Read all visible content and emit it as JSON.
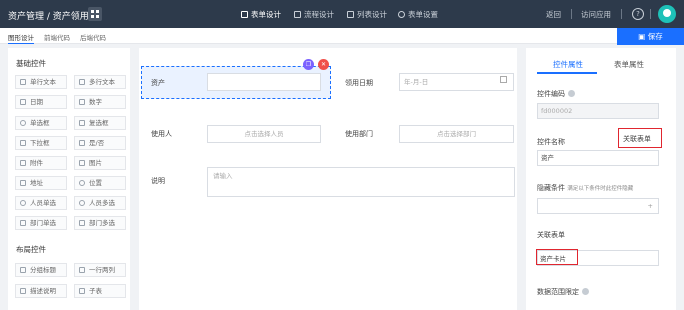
{
  "topbar": {
    "title": "资产管理 / 资产领用",
    "nav": [
      "表单设计",
      "流程设计",
      "列表设计",
      "表单设置"
    ],
    "back": "返回",
    "visit": "访问应用",
    "help": "?"
  },
  "subbar": {
    "tabs": [
      "图形设计",
      "前端代码",
      "后端代码"
    ],
    "save": "保存"
  },
  "left": {
    "basic_title": "基础控件",
    "basic_items": [
      "单行文本",
      "多行文本",
      "日期",
      "数字",
      "单选框",
      "复选框",
      "下拉框",
      "是/否",
      "附件",
      "图片",
      "地址",
      "位置",
      "人员单选",
      "人员多选",
      "部门单选",
      "部门多选"
    ],
    "layout_title": "布局控件",
    "layout_items": [
      "分组标题",
      "一行两列",
      "描述说明",
      "子表"
    ]
  },
  "canvas": {
    "asset_label": "资产",
    "date_label": "领用日期",
    "date_placeholder": "年-月-日",
    "user_label": "使用人",
    "user_placeholder": "点击选择人员",
    "dept_label": "使用部门",
    "dept_placeholder": "点击选择部门",
    "note_label": "说明",
    "note_placeholder": "请输入"
  },
  "props": {
    "tab_control": "控件属性",
    "tab_form": "表单属性",
    "code_label": "控件编码",
    "code_value": "fd000002",
    "name_label": "控件名称",
    "type_badge": "关联表单",
    "name_value": "资产",
    "hide_label": "隐藏条件",
    "hide_hint": "满足以下条件时此控件隐藏",
    "plus": "+",
    "rel_label": "关联表单",
    "rel_value": "资产卡片",
    "range_label": "数据范围限定"
  },
  "colors": {
    "topbar": "#2d3a4b",
    "accent": "#1a6fff",
    "highlight": "#e0262f"
  }
}
